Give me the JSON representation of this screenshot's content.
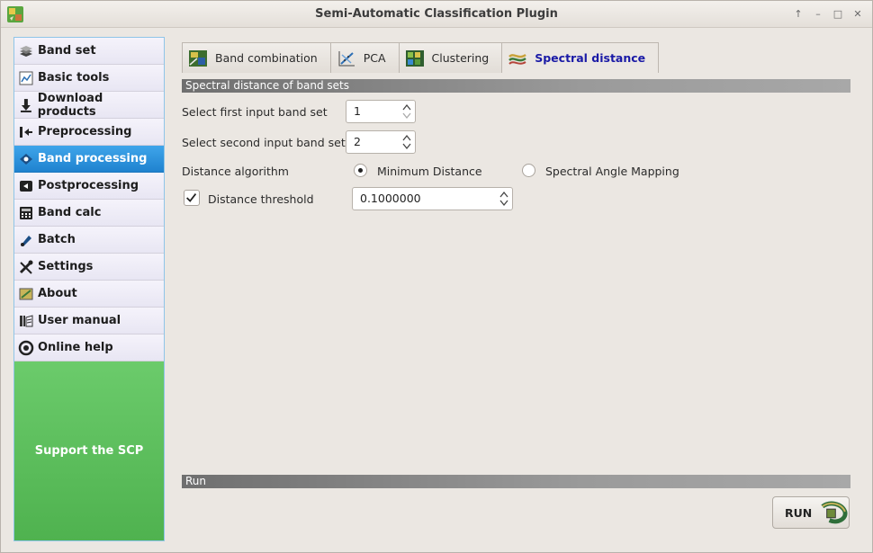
{
  "window": {
    "title": "Semi-Automatic Classification Plugin",
    "controls": [
      "↑",
      "–",
      "□",
      "✕"
    ]
  },
  "sidebar": {
    "items": [
      {
        "label": "Band set",
        "icon": "band-set-icon"
      },
      {
        "label": "Basic tools",
        "icon": "basic-tools-icon"
      },
      {
        "label": "Download products",
        "icon": "download-icon"
      },
      {
        "label": "Preprocessing",
        "icon": "preprocessing-icon"
      },
      {
        "label": "Band processing",
        "icon": "band-processing-icon",
        "active": true
      },
      {
        "label": "Postprocessing",
        "icon": "postprocessing-icon"
      },
      {
        "label": "Band calc",
        "icon": "band-calc-icon"
      },
      {
        "label": "Batch",
        "icon": "batch-icon"
      },
      {
        "label": "Settings",
        "icon": "settings-icon"
      },
      {
        "label": "About",
        "icon": "about-icon"
      },
      {
        "label": "User manual",
        "icon": "user-manual-icon"
      },
      {
        "label": "Online help",
        "icon": "online-help-icon"
      }
    ],
    "support_label": "Support the SCP"
  },
  "tabs": [
    {
      "label": "Band combination",
      "icon": "band-combination-icon"
    },
    {
      "label": "PCA",
      "icon": "pca-icon"
    },
    {
      "label": "Clustering",
      "icon": "clustering-icon"
    },
    {
      "label": "Spectral distance",
      "icon": "spectral-distance-icon",
      "active": true
    }
  ],
  "panel": {
    "section_title": "Spectral distance of band sets",
    "first_band_set_label": "Select first input band set",
    "first_band_set_value": "1",
    "second_band_set_label": "Select second input band set",
    "second_band_set_value": "2",
    "algorithm_label": "Distance algorithm",
    "algorithm_options": [
      {
        "label": "Minimum Distance",
        "checked": true
      },
      {
        "label": "Spectral Angle Mapping",
        "checked": false
      }
    ],
    "threshold_label": "Distance threshold",
    "threshold_checked": true,
    "threshold_value": "0.1000000"
  },
  "run": {
    "section_title": "Run",
    "button_label": "RUN"
  },
  "colors": {
    "active_sidebar": "#2b92dd",
    "support_green": "#5cbe5c",
    "active_tab_text": "#1a1aa6"
  }
}
